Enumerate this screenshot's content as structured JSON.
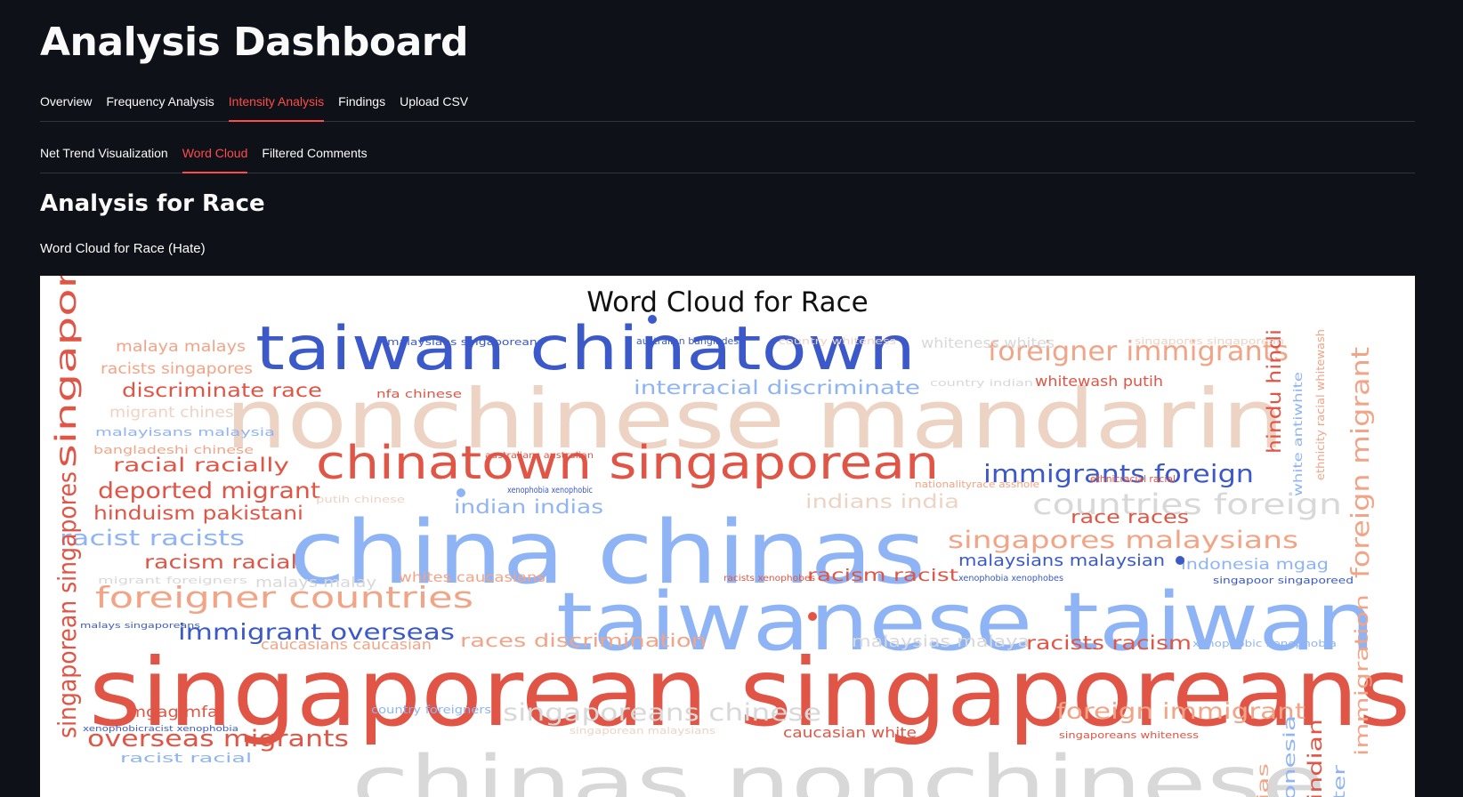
{
  "header": {
    "title": "Analysis Dashboard"
  },
  "main_tabs": [
    {
      "label": "Overview",
      "active": false
    },
    {
      "label": "Frequency Analysis",
      "active": false
    },
    {
      "label": "Intensity Analysis",
      "active": true
    },
    {
      "label": "Findings",
      "active": false
    },
    {
      "label": "Upload CSV",
      "active": false
    }
  ],
  "sub_tabs": [
    {
      "label": "Net Trend Visualization",
      "active": false
    },
    {
      "label": "Word Cloud",
      "active": true
    },
    {
      "label": "Filtered Comments",
      "active": false
    }
  ],
  "section": {
    "title": "Analysis for Race",
    "caption": "Word Cloud for Race (Hate)"
  },
  "wordcloud": {
    "title": "Word Cloud for Race",
    "colors": {
      "blue_dark": "#3b59c8",
      "blue_light": "#8fb4f5",
      "red": "#e05545",
      "peach": "#f2a487",
      "beige": "#edd3c4",
      "gray": "#d8d8d8"
    },
    "words": [
      {
        "text": "taiwan chinatown",
        "color": "blue_dark"
      },
      {
        "text": "nonchinese mandarin",
        "color": "beige"
      },
      {
        "text": "chinatown singaporean",
        "color": "red"
      },
      {
        "text": "china chinas",
        "color": "blue_light"
      },
      {
        "text": "taiwanese taiwan",
        "color": "blue_light"
      },
      {
        "text": "singaporean singaporeans",
        "color": "red"
      },
      {
        "text": "chinas nonchinese",
        "color": "gray"
      },
      {
        "text": "foreigner immigrants",
        "color": "peach"
      },
      {
        "text": "immigrants foreign",
        "color": "blue_dark"
      },
      {
        "text": "countries foreign",
        "color": "gray"
      },
      {
        "text": "singapores malaysians",
        "color": "peach"
      },
      {
        "text": "foreigner countries",
        "color": "peach"
      },
      {
        "text": "interracial discriminate",
        "color": "blue_light"
      },
      {
        "text": "immigrant overseas",
        "color": "blue_dark"
      },
      {
        "text": "overseas migrants",
        "color": "red"
      },
      {
        "text": "deported migrant",
        "color": "red"
      },
      {
        "text": "discriminate race",
        "color": "red"
      },
      {
        "text": "hinduism pakistani",
        "color": "red"
      },
      {
        "text": "racist racists",
        "color": "blue_light"
      },
      {
        "text": "racial racially",
        "color": "red"
      },
      {
        "text": "racism racial",
        "color": "red"
      },
      {
        "text": "malaya malays",
        "color": "peach"
      },
      {
        "text": "racists singapores",
        "color": "peach"
      },
      {
        "text": "migrant chinese",
        "color": "beige"
      },
      {
        "text": "indian indias",
        "color": "blue_light"
      },
      {
        "text": "indians india",
        "color": "beige"
      },
      {
        "text": "race races",
        "color": "red"
      },
      {
        "text": "racism racist",
        "color": "red"
      },
      {
        "text": "malaysians malaysian",
        "color": "blue_dark"
      },
      {
        "text": "indonesia mgag",
        "color": "blue_light"
      },
      {
        "text": "foreign immigrant",
        "color": "peach"
      },
      {
        "text": "racists racism",
        "color": "red"
      },
      {
        "text": "races discrimination",
        "color": "peach"
      },
      {
        "text": "whites caucasians",
        "color": "peach"
      },
      {
        "text": "singaporeans chinese",
        "color": "gray"
      },
      {
        "text": "caucasian white",
        "color": "red"
      },
      {
        "text": "caucasians caucasian",
        "color": "peach"
      },
      {
        "text": "mgag mfa",
        "color": "red"
      },
      {
        "text": "malaysias malaya",
        "color": "gray"
      },
      {
        "text": "malays malay",
        "color": "gray"
      },
      {
        "text": "whitewash putih",
        "color": "red"
      },
      {
        "text": "whiteness whites",
        "color": "gray"
      },
      {
        "text": "singapores",
        "color": "red"
      },
      {
        "text": "singaporean singapores",
        "color": "red"
      },
      {
        "text": "foreign migrant",
        "color": "peach"
      },
      {
        "text": "hindu hindi",
        "color": "red"
      },
      {
        "text": "immigration",
        "color": "peach"
      },
      {
        "text": "malaysians singaporeans",
        "color": "blue_dark"
      },
      {
        "text": "australian bangladesh",
        "color": "blue_dark"
      },
      {
        "text": "country whiteness",
        "color": "beige"
      },
      {
        "text": "singapores singaporean",
        "color": "beige"
      },
      {
        "text": "nfa chinese",
        "color": "red"
      },
      {
        "text": "country indian",
        "color": "gray"
      },
      {
        "text": "malayisans malaysia",
        "color": "blue_light"
      },
      {
        "text": "bangladeshi chinese",
        "color": "peach"
      },
      {
        "text": "putih chinese",
        "color": "beige"
      },
      {
        "text": "migrant foreigners",
        "color": "gray"
      },
      {
        "text": "malays singaporeans",
        "color": "blue_dark"
      },
      {
        "text": "xenophobicracist xenophobia",
        "color": "blue_dark"
      },
      {
        "text": "racist racial",
        "color": "blue_light"
      },
      {
        "text": "country foreigners",
        "color": "blue_light"
      },
      {
        "text": "singaporean malaysians",
        "color": "beige"
      },
      {
        "text": "singapoor singaporeed",
        "color": "blue_dark"
      },
      {
        "text": "xenophobic xenophobia",
        "color": "blue_light"
      },
      {
        "text": "singaporeans whiteness",
        "color": "red"
      },
      {
        "text": "nationalityrace asshole",
        "color": "peach"
      },
      {
        "text": "ethnicracial racial",
        "color": "red"
      },
      {
        "text": "white antiwhite",
        "color": "blue_light"
      },
      {
        "text": "ethnicity racial whitewash",
        "color": "peach"
      },
      {
        "text": "australians australian",
        "color": "red"
      },
      {
        "text": "xenophobia xenophobic",
        "color": "blue_dark"
      },
      {
        "text": "racists xenophobes",
        "color": "red"
      },
      {
        "text": "xenophobia xenophobes",
        "color": "blue_dark"
      },
      {
        "text": "indian",
        "color": "red"
      },
      {
        "text": "onesia",
        "color": "blue_light"
      },
      {
        "text": "ter",
        "color": "blue_light"
      },
      {
        "text": "ias",
        "color": "peach"
      }
    ]
  }
}
